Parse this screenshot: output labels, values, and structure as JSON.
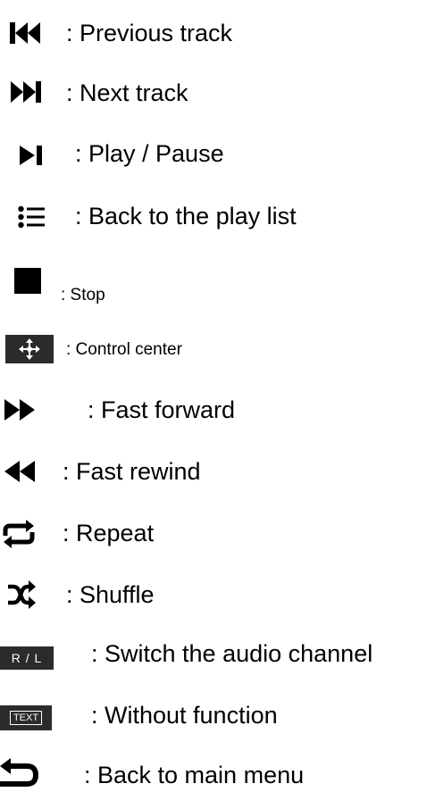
{
  "legend": [
    {
      "icon": "previous-track-icon",
      "label": ": Previous track"
    },
    {
      "icon": "next-track-icon",
      "label": ": Next track"
    },
    {
      "icon": "play-pause-icon",
      "label": ": Play / Pause"
    },
    {
      "icon": "playlist-icon",
      "label": ": Back to the play list"
    },
    {
      "icon": "stop-icon",
      "label": ": Stop"
    },
    {
      "icon": "control-center-icon",
      "label": ": Control center"
    },
    {
      "icon": "fast-forward-icon",
      "label": ": Fast forward"
    },
    {
      "icon": "fast-rewind-icon",
      "label": ": Fast rewind"
    },
    {
      "icon": "repeat-icon",
      "label": ": Repeat"
    },
    {
      "icon": "shuffle-icon",
      "label": ": Shuffle"
    },
    {
      "icon": "audio-channel-icon",
      "badge": "R / L",
      "label": ": Switch the audio channel"
    },
    {
      "icon": "text-icon",
      "badge": "TEXT",
      "label": ": Without function"
    },
    {
      "icon": "back-to-main-menu-icon",
      "label": ": Back to main menu"
    }
  ]
}
